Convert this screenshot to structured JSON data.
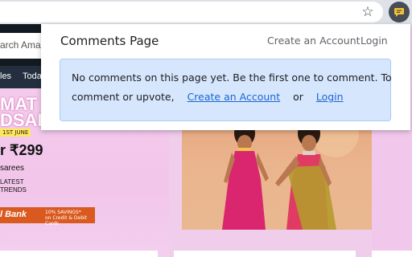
{
  "browser": {
    "bookmark_icon": "star-outline-icon",
    "extension_icon": "comment-bubble-icon",
    "extension_icon_color": "#f2c230"
  },
  "background_page": {
    "search_placeholder": "arch Ama",
    "nav_items": [
      "les",
      "Toda"
    ],
    "sale_lines": [
      "MAT",
      "DSAL"
    ],
    "sale_date": "1ST JUNE",
    "price": "r ₹299",
    "product": "sarees",
    "trend_lines": [
      "LATEST",
      "TRENDS"
    ],
    "bank_name": "l Bank",
    "bank_offer_lines": [
      "10% SAVINGS*",
      "on Credit & Debit Cards"
    ]
  },
  "popup": {
    "title": "Comments Page",
    "nav": {
      "create_account": "Create an Account",
      "login": "Login"
    },
    "notice": {
      "line1": "No comments on this page yet. Be the first one to comment. To",
      "line2_prefix": "comment or upvote,",
      "create_account_link": "Create an Account",
      "or": "or",
      "login_link": "Login"
    },
    "colors": {
      "notice_bg": "#d6e6fd",
      "notice_border": "#aacaf7",
      "link": "#1a66d2"
    }
  }
}
